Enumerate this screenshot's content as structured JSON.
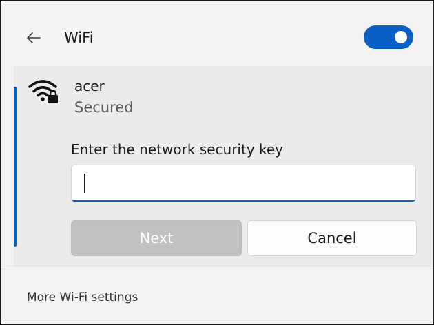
{
  "header": {
    "title": "WiFi",
    "back_icon": "back-arrow-icon",
    "wifi_toggle_on": true
  },
  "network": {
    "name": "acer",
    "status": "Secured",
    "icon": "wifi-secured-icon",
    "key_label": "Enter the network security key",
    "key_value": "",
    "next_label": "Next",
    "cancel_label": "Cancel"
  },
  "footer": {
    "more_settings_label": "More Wi-Fi settings"
  },
  "colors": {
    "accent": "#0a5fc7",
    "background": "#f3f3f3",
    "card": "#ebebeb",
    "disabled_button": "#c1c1c1"
  }
}
